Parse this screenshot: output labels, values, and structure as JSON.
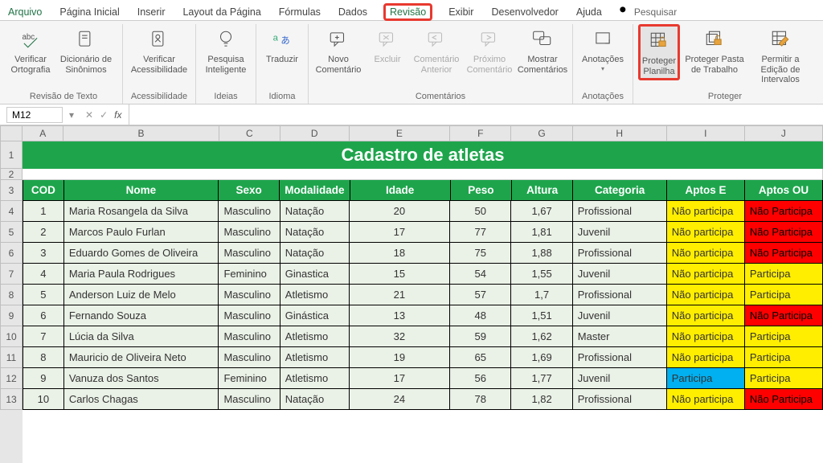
{
  "tabs": {
    "file": "Arquivo",
    "home": "Página Inicial",
    "insert": "Inserir",
    "layout": "Layout da Página",
    "formulas": "Fórmulas",
    "data": "Dados",
    "review": "Revisão",
    "view": "Exibir",
    "developer": "Desenvolvedor",
    "help": "Ajuda",
    "search": "Pesquisar"
  },
  "ribbon": {
    "proofing": {
      "label": "Revisão de Texto",
      "spell": "Verificar Ortografia",
      "thesaurus": "Dicionário de Sinônimos"
    },
    "accessibility": {
      "label": "Acessibilidade",
      "check": "Verificar Acessibilidade"
    },
    "insights": {
      "label": "Ideias",
      "smart": "Pesquisa Inteligente"
    },
    "language": {
      "label": "Idioma",
      "translate": "Traduzir"
    },
    "comments": {
      "label": "Comentários",
      "new": "Novo Comentário",
      "delete": "Excluir",
      "prev": "Comentário Anterior",
      "next": "Próximo Comentário",
      "show": "Mostrar Comentários"
    },
    "notes": {
      "label": "Anotações",
      "notes": "Anotações"
    },
    "protect": {
      "label": "Proteger",
      "sheet": "Proteger Planilha",
      "workbook": "Proteger Pasta de Trabalho",
      "ranges": "Permitir a Edição de Intervalos"
    }
  },
  "namebox": "M12",
  "sheet": {
    "title": "Cadastro de atletas",
    "columns": [
      "A",
      "B",
      "C",
      "D",
      "E",
      "F",
      "G",
      "H",
      "I",
      "J"
    ],
    "headers": [
      "COD",
      "Nome",
      "Sexo",
      "Modalidade",
      "Idade",
      "Peso",
      "Altura",
      "Categoria",
      "Aptos E",
      "Aptos OU"
    ],
    "rows": [
      {
        "n": "1",
        "cod": "1",
        "nome": "Maria Rosangela da Silva",
        "sexo": "Masculino",
        "mod": "Natação",
        "idade": "20",
        "peso": "50",
        "alt": "1,67",
        "cat": "Profissional",
        "e": {
          "txt": "Não participa",
          "cls": "yellow"
        },
        "ou": {
          "txt": "Não Participa",
          "cls": "red"
        }
      },
      {
        "n": "2",
        "cod": "2",
        "nome": "Marcos Paulo Furlan",
        "sexo": "Masculino",
        "mod": "Natação",
        "idade": "17",
        "peso": "77",
        "alt": "1,81",
        "cat": "Juvenil",
        "e": {
          "txt": "Não participa",
          "cls": "yellow"
        },
        "ou": {
          "txt": "Não Participa",
          "cls": "red"
        }
      },
      {
        "n": "3",
        "cod": "3",
        "nome": "Eduardo Gomes de Oliveira",
        "sexo": "Masculino",
        "mod": "Natação",
        "idade": "18",
        "peso": "75",
        "alt": "1,88",
        "cat": "Profissional",
        "e": {
          "txt": "Não participa",
          "cls": "yellow"
        },
        "ou": {
          "txt": "Não Participa",
          "cls": "red"
        }
      },
      {
        "n": "4",
        "cod": "4",
        "nome": "Maria Paula Rodrigues",
        "sexo": "Feminino",
        "mod": "Ginastica",
        "idade": "15",
        "peso": "54",
        "alt": "1,55",
        "cat": "Juvenil",
        "e": {
          "txt": "Não participa",
          "cls": "yellow"
        },
        "ou": {
          "txt": "Participa",
          "cls": "yellow"
        }
      },
      {
        "n": "5",
        "cod": "5",
        "nome": "Anderson Luiz de Melo",
        "sexo": "Masculino",
        "mod": "Atletismo",
        "idade": "21",
        "peso": "57",
        "alt": "1,7",
        "cat": "Profissional",
        "e": {
          "txt": "Não participa",
          "cls": "yellow"
        },
        "ou": {
          "txt": "Participa",
          "cls": "yellow"
        }
      },
      {
        "n": "6",
        "cod": "6",
        "nome": "Fernando Souza",
        "sexo": "Masculino",
        "mod": "Ginástica",
        "idade": "13",
        "peso": "48",
        "alt": "1,51",
        "cat": "Juvenil",
        "e": {
          "txt": "Não participa",
          "cls": "yellow"
        },
        "ou": {
          "txt": "Não Participa",
          "cls": "red"
        }
      },
      {
        "n": "7",
        "cod": "7",
        "nome": "Lúcia da Silva",
        "sexo": "Masculino",
        "mod": "Atletismo",
        "idade": "32",
        "peso": "59",
        "alt": "1,62",
        "cat": "Master",
        "e": {
          "txt": "Não participa",
          "cls": "yellow"
        },
        "ou": {
          "txt": "Participa",
          "cls": "yellow"
        }
      },
      {
        "n": "8",
        "cod": "8",
        "nome": "Mauricio de Oliveira Neto",
        "sexo": "Masculino",
        "mod": "Atletismo",
        "idade": "19",
        "peso": "65",
        "alt": "1,69",
        "cat": "Profissional",
        "e": {
          "txt": "Não participa",
          "cls": "yellow"
        },
        "ou": {
          "txt": "Participa",
          "cls": "yellow"
        }
      },
      {
        "n": "9",
        "cod": "9",
        "nome": "Vanuza dos Santos",
        "sexo": "Feminino",
        "mod": "Atletismo",
        "idade": "17",
        "peso": "56",
        "alt": "1,77",
        "cat": "Juvenil",
        "e": {
          "txt": "Participa",
          "cls": "cyan"
        },
        "ou": {
          "txt": "Participa",
          "cls": "yellow"
        }
      },
      {
        "n": "10",
        "cod": "10",
        "nome": "Carlos Chagas",
        "sexo": "Masculino",
        "mod": "Natação",
        "idade": "24",
        "peso": "78",
        "alt": "1,82",
        "cat": "Profissional",
        "e": {
          "txt": "Não participa",
          "cls": "yellow"
        },
        "ou": {
          "txt": "Não Participa",
          "cls": "red"
        }
      }
    ]
  }
}
